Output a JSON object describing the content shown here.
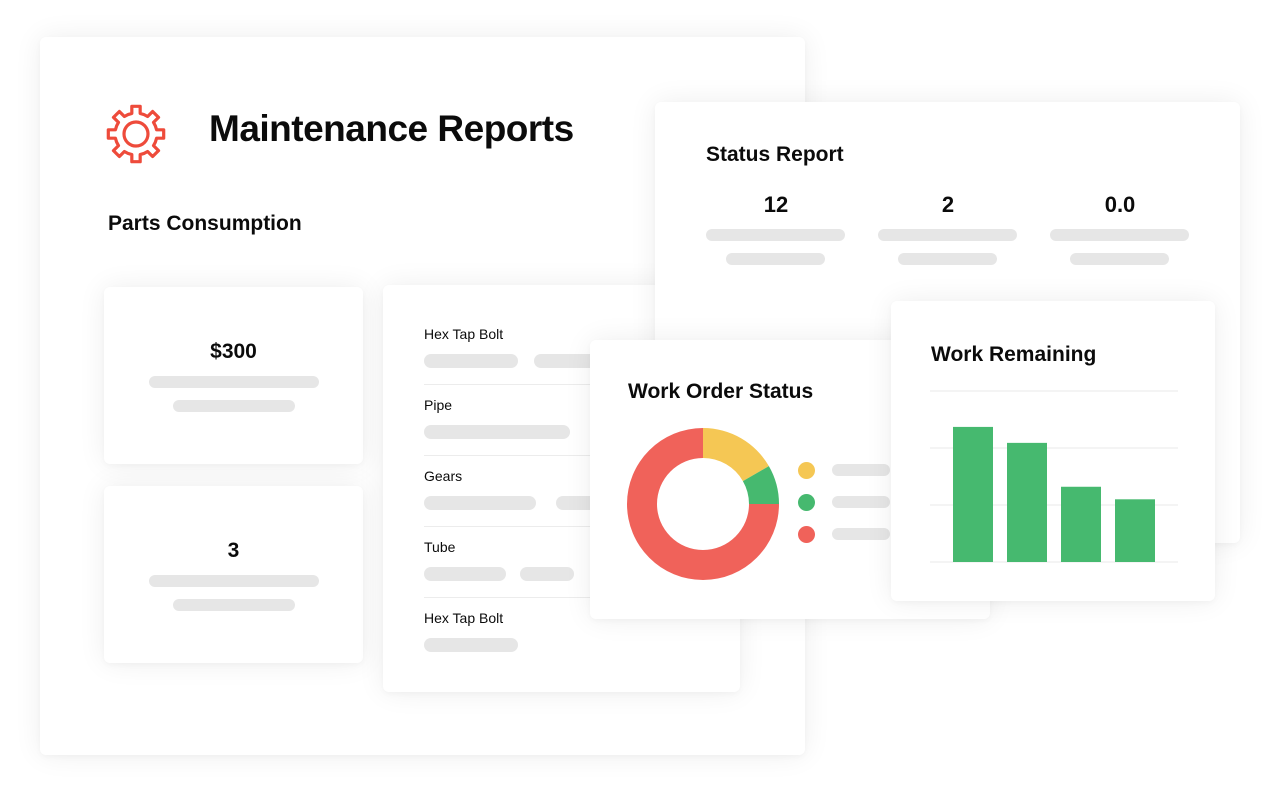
{
  "header": {
    "icon": "gear-icon",
    "title": "Maintenance Reports",
    "accent_color": "#ee4b3b"
  },
  "parts_consumption": {
    "title": "Parts Consumption",
    "kpis": [
      {
        "value": "$300"
      },
      {
        "value": "3"
      }
    ],
    "items": [
      {
        "label": "Hex Tap Bolt"
      },
      {
        "label": "Pipe"
      },
      {
        "label": "Gears"
      },
      {
        "label": "Tube"
      },
      {
        "label": "Hex Tap Bolt"
      }
    ]
  },
  "status_report": {
    "title": "Status Report",
    "stats": [
      {
        "value": "12"
      },
      {
        "value": "2"
      },
      {
        "value": "0.0"
      }
    ]
  },
  "work_order_status": {
    "title": "Work Order Status"
  },
  "work_remaining": {
    "title": "Work Remaining"
  },
  "chart_data": [
    {
      "type": "pie",
      "title": "Work Order Status",
      "donut": true,
      "slices": [
        {
          "name": "",
          "value": 16.7,
          "color": "#f5c754"
        },
        {
          "name": "",
          "value": 8.3,
          "color": "#46b96f"
        },
        {
          "name": "",
          "value": 75.0,
          "color": "#f0625a"
        }
      ],
      "legend": "right"
    },
    {
      "type": "bar",
      "title": "Work Remaining",
      "categories": [
        "",
        "",
        "",
        ""
      ],
      "values": [
        2.37,
        2.09,
        1.32,
        1.1
      ],
      "ylim": [
        0,
        3
      ],
      "grid": true,
      "color": "#46b96f",
      "xlabel": "",
      "ylabel": ""
    }
  ]
}
